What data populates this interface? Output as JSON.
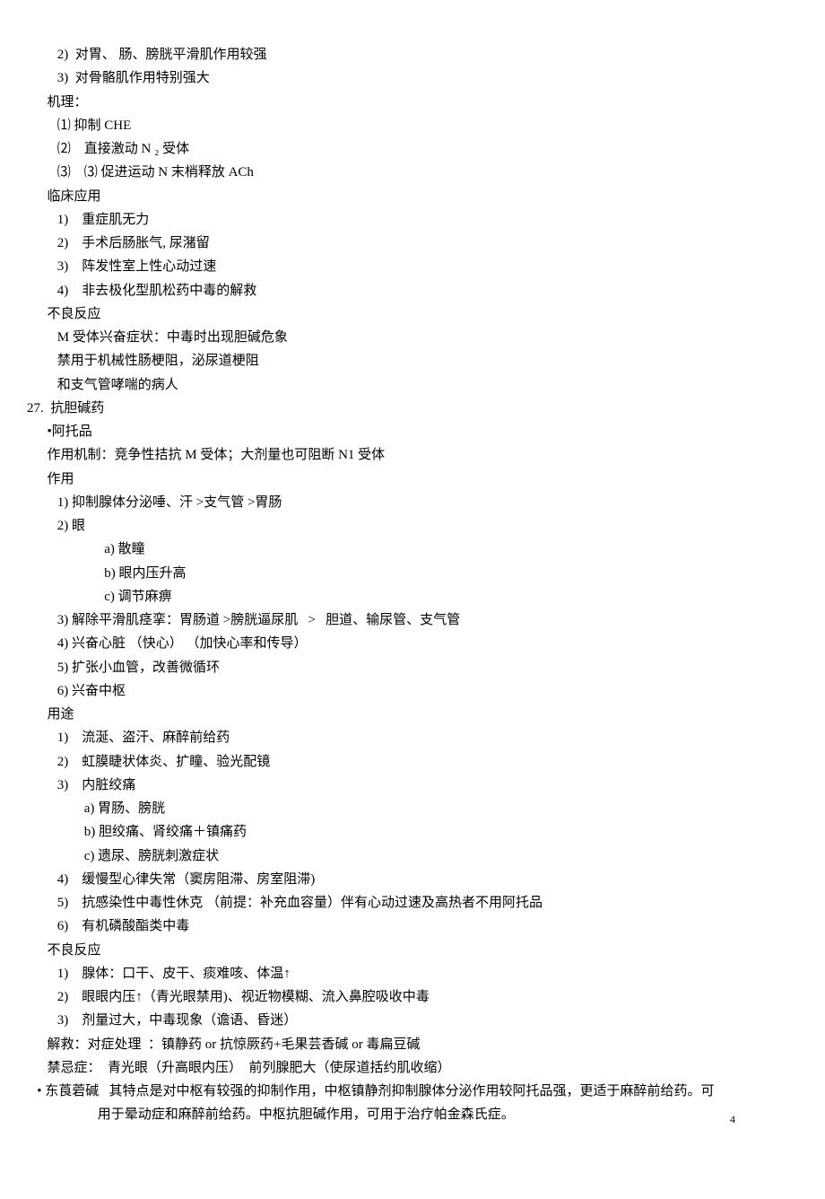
{
  "lines": {
    "l1": "         2)  对胃、 肠、膀胱平滑肌作用较强",
    "l2": "         3)  对骨骼肌作用特别强大",
    "l3": "      机理：",
    "l4": "         ⑴ 抑制 CHE",
    "l5": "         ⑵    直接激动 N ₂ 受体",
    "l6": "         ⑶    ⑶ 促进运动 N 末梢释放 ACh",
    "l7": "      临床应用",
    "l8": "         1)    重症肌无力",
    "l9": "         2)    手术后肠胀气, 尿潴留",
    "l10": "         3)    阵发性室上性心动过速",
    "l11": "         4)    非去极化型肌松药中毒的解救",
    "l12": "      不良反应",
    "l13": "         M 受体兴奋症状：中毒时出现胆碱危象",
    "l14": "         禁用于机械性肠梗阻，泌尿道梗阻",
    "l15": "         和支气管哮喘的病人",
    "l16": "27.  抗胆碱药",
    "l17": "      •阿托品",
    "l18": "      作用机制：竞争性拮抗 M 受体；大剂量也可阻断 N1 受体",
    "l19": "      作用",
    "l20": "         1) 抑制腺体分泌唾、汗 >支气管 >胃肠",
    "l21": "         2) 眼",
    "l22": "                       a) 散瞳",
    "l23": "                       b) 眼内压升高",
    "l24": "                       c) 调节麻痹",
    "l25": "         3) 解除平滑肌痉挛：胃肠道 >膀胱逼尿肌   >   胆道、输尿管、支气管",
    "l26": "         4) 兴奋心脏 （快心） （加快心率和传导）",
    "l27": "         5) 扩张小血管，改善微循环",
    "l28": "         6) 兴奋中枢",
    "l29": "      用途",
    "l30": "         1)    流涎、盗汗、麻醉前给药",
    "l31": "         2)    虹膜睫状体炎、扩瞳、验光配镜",
    "l32": "         3)    内脏绞痛",
    "l33": "                 a) 胃肠、膀胱",
    "l34": "                 b) 胆绞痛、肾绞痛＋镇痛药",
    "l35": "                 c) 遗尿、膀胱刺激症状",
    "l36": "         4)    缓慢型心律失常（窦房阻滞、房室阻滞)",
    "l37": "         5)    抗感染性中毒性休克 （前提：补充血容量）伴有心动过速及高热者不用阿托品",
    "l38": "         6)    有机磷酸酯类中毒",
    "l39": "",
    "l40": "      不良反应",
    "l41": "         1)    腺体：口干、皮干、痰难咳、体温↑",
    "l42": "         2)    眼眼内压↑（青光眼禁用)、视近物模糊、流入鼻腔吸收中毒",
    "l43": "         3)    剂量过大，中毒现象（谵语、昏迷）",
    "l44": "      解救：对症处理  ：镇静药 or 抗惊厥药+毛果芸香碱 or 毒扁豆碱",
    "l45": "      禁忌症：  青光眼（升高眼内压）  前列腺肥大（使尿道括约肌收缩）",
    "l46": "",
    "l47": "   • 东莨菪碱   其特点是对中枢有较强的抑制作用，中枢镇静剂抑制腺体分泌作用较阿托品强，更适于麻醉前给药。可",
    "l48": "                     用于晕动症和麻醉前给药。中枢抗胆碱作用，可用于治疗帕金森氏症。"
  },
  "pageNumber": "4"
}
